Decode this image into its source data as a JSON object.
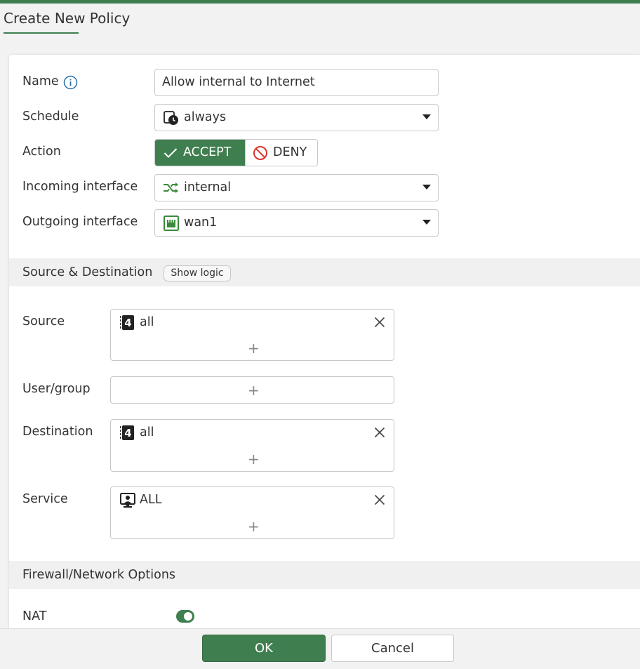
{
  "page": {
    "title": "Create New Policy"
  },
  "colors": {
    "accent": "#3f7f4f",
    "deny_red": "#d9342b",
    "interface_green": "#3a8a3a"
  },
  "form": {
    "name_label": "Name",
    "name_value": "Allow internal to Internet",
    "schedule_label": "Schedule",
    "schedule_value": "always",
    "action_label": "Action",
    "action_accept": "ACCEPT",
    "action_deny": "DENY",
    "action_selected": "ACCEPT",
    "incoming_label": "Incoming interface",
    "incoming_value": "internal",
    "outgoing_label": "Outgoing interface",
    "outgoing_value": "wan1"
  },
  "source_destination": {
    "title": "Source & Destination",
    "show_logic": "Show logic",
    "source_label": "Source",
    "source_entries": [
      "all"
    ],
    "user_group_label": "User/group",
    "destination_label": "Destination",
    "destination_entries": [
      "all"
    ],
    "service_label": "Service",
    "service_entries": [
      "ALL"
    ]
  },
  "firewall": {
    "title": "Firewall/Network Options",
    "nat_label": "NAT",
    "nat_enabled": true
  },
  "footer": {
    "ok": "OK",
    "cancel": "Cancel"
  }
}
